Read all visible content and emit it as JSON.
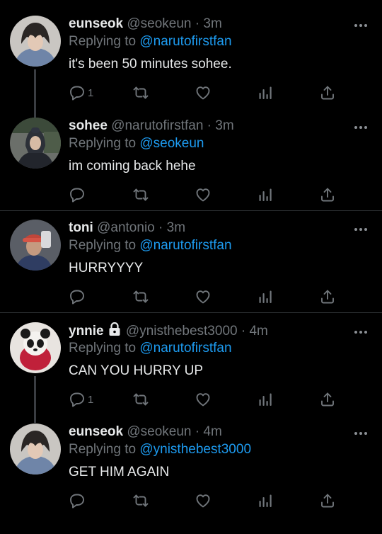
{
  "tweets": [
    {
      "name": "eunseok",
      "handle": "@seokeun",
      "dot": "·",
      "time": "3m",
      "reply_prefix": "Replying to",
      "reply_to": "@narutofirstfan",
      "text": "it's been 50 minutes sohee.",
      "reply_count": "1",
      "locked": false
    },
    {
      "name": "sohee",
      "handle": "@narutofirstfan",
      "dot": "·",
      "time": "3m",
      "reply_prefix": "Replying to",
      "reply_to": "@seokeun",
      "text": "im coming back hehe",
      "reply_count": "",
      "locked": false
    },
    {
      "name": "toni",
      "handle": "@antonio",
      "dot": "·",
      "time": "3m",
      "reply_prefix": "Replying to",
      "reply_to": "@narutofirstfan",
      "text": "HURRYYYY",
      "reply_count": "",
      "locked": false
    },
    {
      "name": "ynnie",
      "handle": "@ynisthebest3000",
      "dot": "·",
      "time": "4m",
      "reply_prefix": "Replying to",
      "reply_to": "@narutofirstfan",
      "text": "CAN YOU HURRY UP",
      "reply_count": "1",
      "locked": true
    },
    {
      "name": "eunseok",
      "handle": "@seokeun",
      "dot": "·",
      "time": "4m",
      "reply_prefix": "Replying to",
      "reply_to": "@ynisthebest3000",
      "text": "GET HIM AGAIN",
      "reply_count": "",
      "locked": false
    }
  ],
  "icons": [
    "reply-icon",
    "retweet-icon",
    "like-icon",
    "analytics-icon",
    "share-icon",
    "more-icon",
    "lock-icon"
  ],
  "colors": {
    "background": "#000000",
    "text": "#e7e9ea",
    "muted": "#71767b",
    "link": "#1d9bf0",
    "divider": "#2f3336"
  }
}
